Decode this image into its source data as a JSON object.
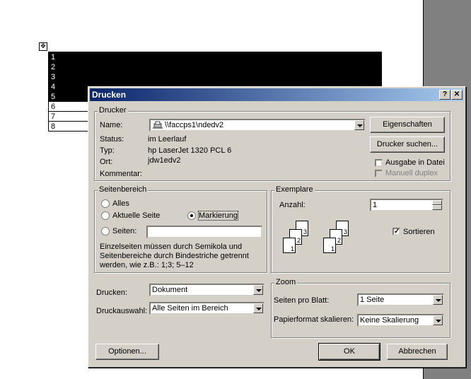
{
  "document": {
    "rows": [
      {
        "label": "1",
        "selected": true
      },
      {
        "label": "2",
        "selected": true
      },
      {
        "label": "3",
        "selected": true
      },
      {
        "label": "4",
        "selected": true
      },
      {
        "label": "5",
        "selected": true
      },
      {
        "label": "6",
        "selected": false
      },
      {
        "label": "7",
        "selected": false
      },
      {
        "label": "8",
        "selected": false
      }
    ]
  },
  "dialog": {
    "title": "Drucken",
    "title_buttons": {
      "help": "?",
      "close": "✕"
    },
    "printer": {
      "group_label": "Drucker",
      "name_label": "Name:",
      "name_value": "\\\\faccps1\\ndedv2",
      "status_label": "Status:",
      "status_value": "im Leerlauf",
      "type_label": "Typ:",
      "type_value": "hp LaserJet 1320 PCL 6",
      "location_label": "Ort:",
      "location_value": "jdw1edv2",
      "comment_label": "Kommentar:",
      "properties_button": "Eigenschaften",
      "find_printer_button": "Drucker suchen...",
      "print_to_file_label": "Ausgabe in Datei",
      "manual_duplex_label": "Manuell duplex"
    },
    "page_range": {
      "group_label": "Seitenbereich",
      "all_label": "Alles",
      "current_page_label": "Aktuelle Seite",
      "selection_label": "Markierung",
      "pages_label": "Seiten:",
      "pages_value": "",
      "hint": "Einzelseiten müssen durch Semikola und Seitenbereiche durch Bindestriche getrennt werden, wie z.B.: 1;3; 5–12"
    },
    "copies": {
      "group_label": "Exemplare",
      "count_label": "Anzahl:",
      "count_value": "1",
      "collate_label": "Sortieren",
      "collate_checked": true,
      "page_numbers": [
        "3",
        "2",
        "1"
      ]
    },
    "print_what_label": "Drucken:",
    "print_what_value": "Dokument",
    "print_select_label": "Druckauswahl:",
    "print_select_value": "Alle Seiten im Bereich",
    "zoom": {
      "group_label": "Zoom",
      "pages_per_sheet_label": "Seiten pro Blatt:",
      "pages_per_sheet_value": "1 Seite",
      "scale_label": "Papierformat skalieren:",
      "scale_value": "Keine Skalierung"
    },
    "options_button": "Optionen...",
    "ok_button": "OK",
    "cancel_button": "Abbrechen"
  }
}
